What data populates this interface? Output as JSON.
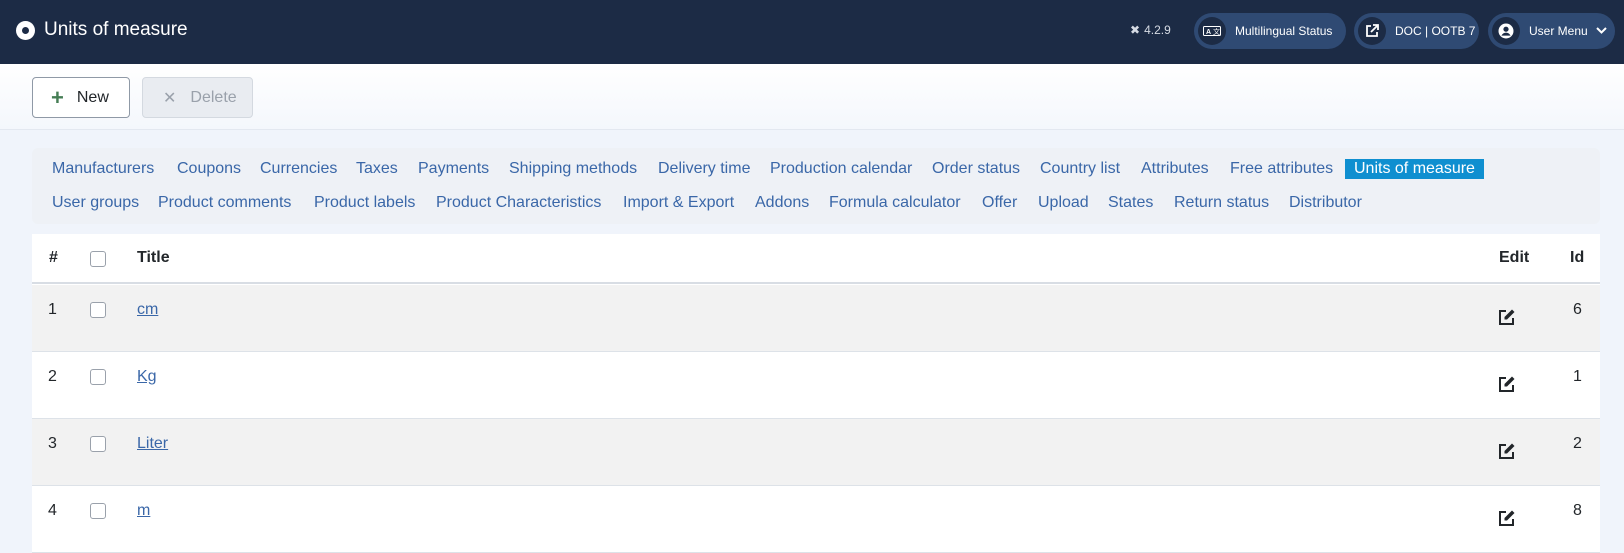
{
  "header": {
    "title": "Units of measure",
    "version": "4.2.9",
    "multilingual_label": "Multilingual Status",
    "doc_label": "DOC | OOTB 7",
    "user_menu_label": "User Menu"
  },
  "toolbar": {
    "new_label": "New",
    "delete_label": "Delete"
  },
  "submenu": {
    "items": [
      "Manufacturers",
      "Coupons",
      "Currencies",
      "Taxes",
      "Payments",
      "Shipping methods",
      "Delivery time",
      "Production calendar",
      "Order status",
      "Country list",
      "Attributes",
      "Free attributes",
      "Units of measure",
      "User groups",
      "Product comments",
      "Product labels",
      "Product Characteristics",
      "Import & Export",
      "Addons",
      "Formula calculator",
      "Offer",
      "Upload",
      "States",
      "Return status",
      "Distributor"
    ],
    "active": "Units of measure"
  },
  "table": {
    "headers": {
      "num": "#",
      "title": "Title",
      "edit": "Edit",
      "id": "Id"
    },
    "rows": [
      {
        "num": "1",
        "title": "cm",
        "id": "6"
      },
      {
        "num": "2",
        "title": "Kg",
        "id": "1"
      },
      {
        "num": "3",
        "title": "Liter",
        "id": "2"
      },
      {
        "num": "4",
        "title": "m",
        "id": "8"
      }
    ]
  },
  "colors": {
    "header_bg": "#1c2b45",
    "link": "#3a67a8",
    "active_tab": "#0f8fd0",
    "new_icon": "#457d54"
  }
}
